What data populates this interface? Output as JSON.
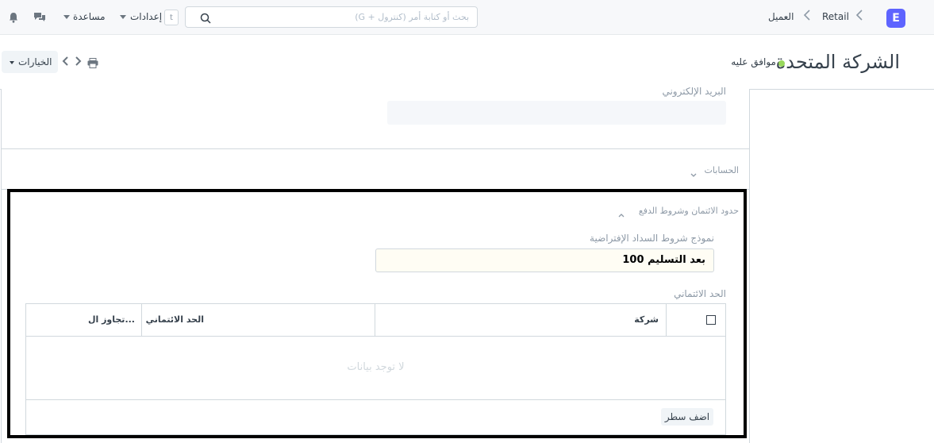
{
  "navbar": {
    "logo_letter": "E",
    "breadcrumbs": [
      "Retail",
      "العميل"
    ],
    "search_placeholder": "بحث أو كتابة أمر (كنترول + G)",
    "shortcut_key": "t",
    "settings_label": "إعدادات",
    "help_label": "مساعدة",
    "icons": [
      "search-icon",
      "chat-icon",
      "bell-icon"
    ]
  },
  "page_head": {
    "title": "الشركة المتحدة",
    "status": "موافق عليه",
    "status_color": "#98d85b",
    "options_label": "الخيارات"
  },
  "form": {
    "email_label": "البريد الإلكتروني",
    "email_value": "",
    "accounts_section": "الحسابات",
    "credit_section": "حدود الائتمان وشروط الدفع",
    "payment_terms_label": "نموذج شروط السداد الإفتراضية",
    "payment_terms_value": "100 بعد التسليم",
    "credit_limit_label": "الحد الائتماني",
    "grid": {
      "columns": [
        "شركة",
        "الحد الائتماني",
        "تجاوز ال..."
      ],
      "rows": [],
      "empty_text": "لا توجد بيانات",
      "add_row_label": "اضف سطر"
    }
  }
}
